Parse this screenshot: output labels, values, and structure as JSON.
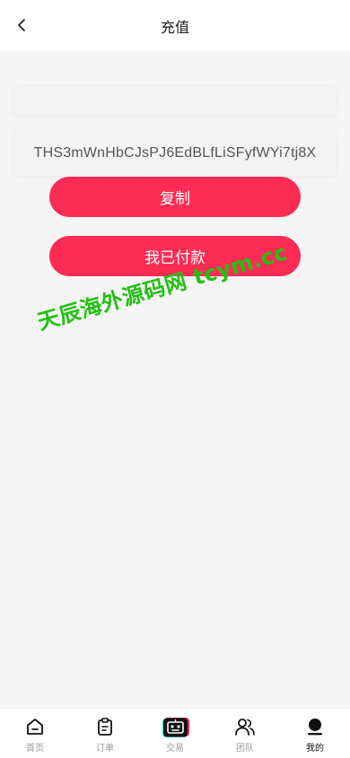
{
  "header": {
    "title": "充值"
  },
  "recharge": {
    "empty_field": "",
    "address": "THS3mWnHbCJsPJ6EdBLfLiSFyfWYi7tj8X",
    "copy_label": "复制",
    "paid_label": "我已付款"
  },
  "watermark": {
    "text": "天辰海外源码网 tcym.cc"
  },
  "tabbar": {
    "items": [
      {
        "label": "首页",
        "icon": "home-icon"
      },
      {
        "label": "订单",
        "icon": "clipboard-icon"
      },
      {
        "label": "交易",
        "icon": "robot-icon"
      },
      {
        "label": "团队",
        "icon": "team-icon"
      },
      {
        "label": "我的",
        "icon": "user-icon"
      }
    ],
    "active_index": 4
  },
  "colors": {
    "accent": "#fe2c55",
    "watermark": "#22c010",
    "background": "#f5f5f6"
  }
}
